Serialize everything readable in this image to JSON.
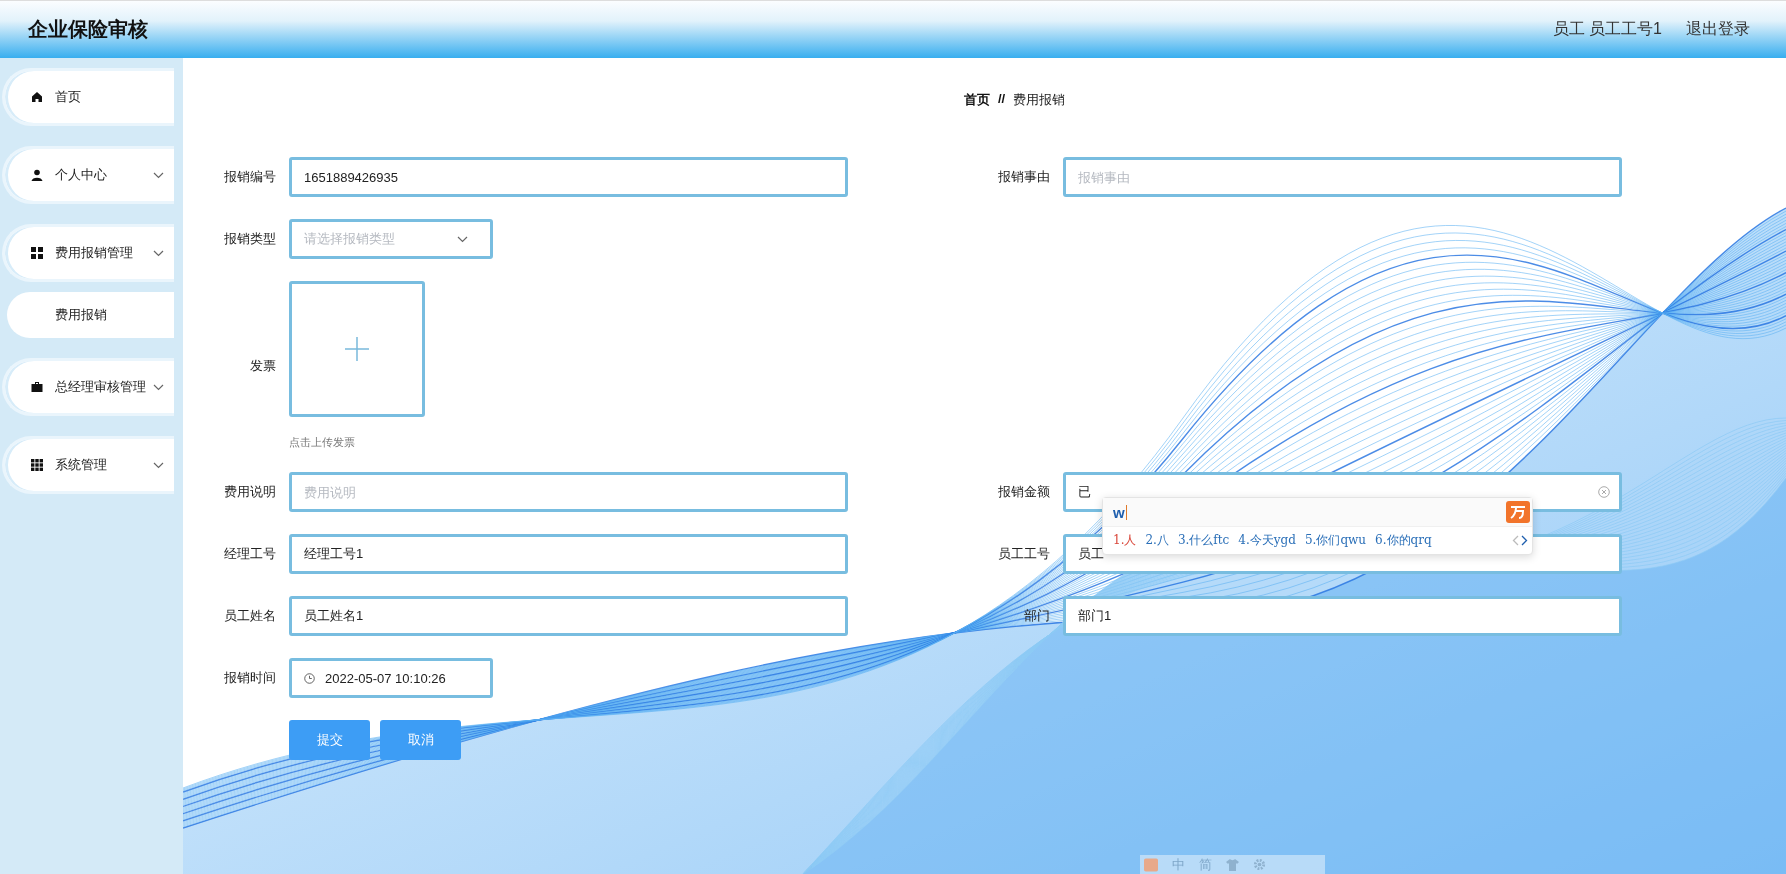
{
  "header": {
    "title": "企业保险审核",
    "user": "员工 员工工号1",
    "logout": "退出登录"
  },
  "sidebar": {
    "items": [
      {
        "label": "首页",
        "kind": "link"
      },
      {
        "label": "个人中心",
        "kind": "menu"
      },
      {
        "label": "费用报销管理",
        "kind": "menu",
        "children": [
          {
            "label": "费用报销"
          }
        ]
      },
      {
        "label": "总经理审核管理",
        "kind": "menu"
      },
      {
        "label": "系统管理",
        "kind": "menu"
      }
    ]
  },
  "breadcrumb": {
    "home": "首页",
    "separator": "//",
    "current": "费用报销"
  },
  "form": {
    "rows": [
      [
        {
          "label": "报销编号",
          "kind": "text",
          "value": "1651889426935"
        },
        {
          "label": "报销事由",
          "kind": "text",
          "placeholder": "报销事由"
        }
      ],
      [
        {
          "label": "报销类型",
          "kind": "select",
          "placeholder": "请选择报销类型"
        }
      ],
      [
        {
          "label": "发票",
          "kind": "upload",
          "hint": "点击上传发票"
        }
      ],
      [
        {
          "label": "费用说明",
          "kind": "text",
          "placeholder": "费用说明"
        },
        {
          "label": "报销金额",
          "kind": "text",
          "value": "已",
          "clearable": true
        }
      ],
      [
        {
          "label": "经理工号",
          "kind": "text",
          "value": "经理工号1"
        },
        {
          "label": "员工工号",
          "kind": "text",
          "value": "员工"
        }
      ],
      [
        {
          "label": "员工姓名",
          "kind": "text",
          "value": "员工姓名1"
        },
        {
          "label": "部门",
          "kind": "text",
          "value": "部门1"
        }
      ],
      [
        {
          "label": "报销时间",
          "kind": "datetime",
          "value": "2022-05-07 10:10:26"
        }
      ]
    ],
    "buttons": [
      {
        "label": "提交",
        "kind": "primary"
      },
      {
        "label": "取消",
        "kind": "primary"
      }
    ]
  },
  "ime_popup": {
    "composition": "w",
    "candidates": [
      {
        "label": "1.人",
        "selected": true
      },
      {
        "label": "2.八",
        "selected": false
      },
      {
        "label": "3.什么ftc",
        "selected": false
      },
      {
        "label": "4.今天ygd",
        "selected": false
      },
      {
        "label": "5.你们qwu",
        "selected": false
      },
      {
        "label": "6.你的qrq",
        "selected": false
      }
    ]
  },
  "ime_toolbar": {
    "items": [
      "中",
      "简"
    ]
  }
}
